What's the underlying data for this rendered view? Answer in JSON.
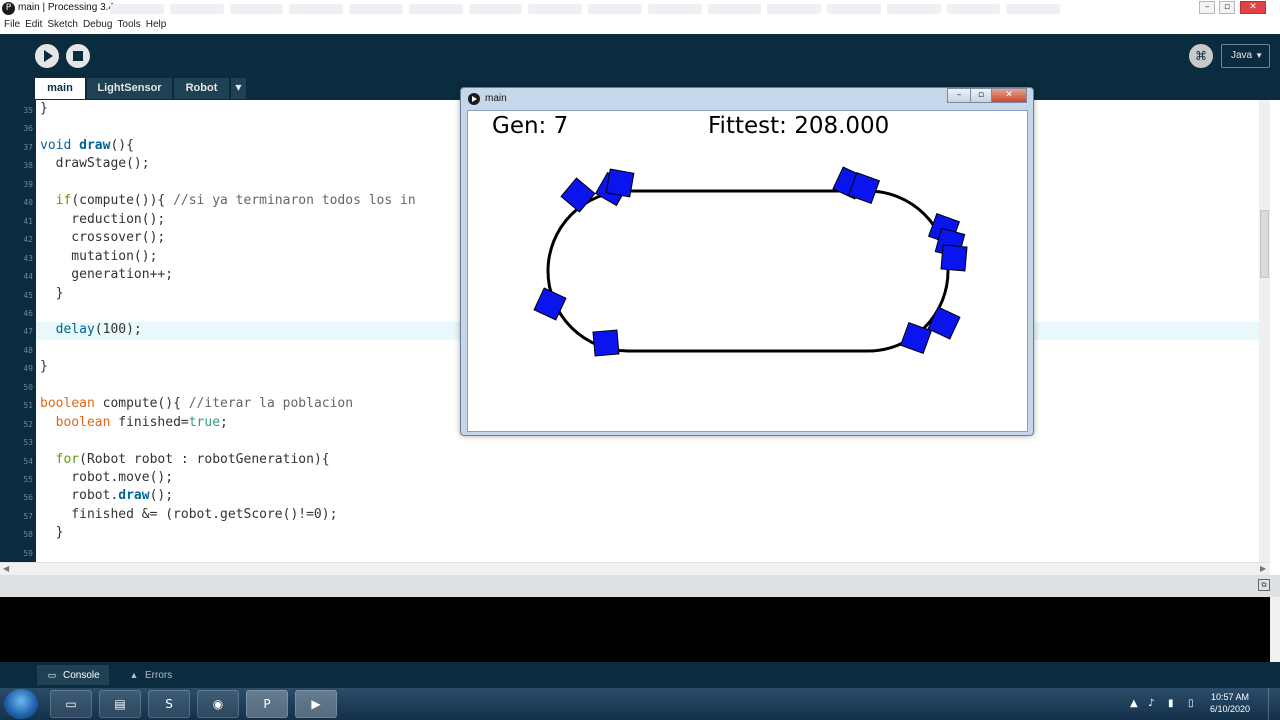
{
  "window": {
    "title": "main | Processing 3.4"
  },
  "menu": [
    "File",
    "Edit",
    "Sketch",
    "Debug",
    "Tools",
    "Help"
  ],
  "toolbar": {
    "mode": "Java"
  },
  "tabs": [
    "main",
    "LightSensor",
    "Robot"
  ],
  "editor": {
    "highlighted_line": 47,
    "lines": [
      {
        "n": 35,
        "tokens": [
          [
            "}",
            ""
          ]
        ]
      },
      {
        "n": 36,
        "tokens": []
      },
      {
        "n": 37,
        "tokens": [
          [
            "void ",
            "kw-blue"
          ],
          [
            "draw",
            "kw-fn"
          ],
          [
            "(){",
            ""
          ]
        ]
      },
      {
        "n": 38,
        "tokens": [
          [
            "  drawStage();",
            ""
          ]
        ]
      },
      {
        "n": 39,
        "tokens": []
      },
      {
        "n": 40,
        "tokens": [
          [
            "  ",
            ""
          ],
          [
            "if",
            "kw-ctrl"
          ],
          [
            "(compute()){ ",
            ""
          ],
          [
            "//si ya terminaron todos los in",
            "cmt"
          ]
        ]
      },
      {
        "n": 41,
        "tokens": [
          [
            "    reduction();",
            ""
          ]
        ]
      },
      {
        "n": 42,
        "tokens": [
          [
            "    crossover();",
            ""
          ]
        ]
      },
      {
        "n": 43,
        "tokens": [
          [
            "    mutation();",
            ""
          ]
        ]
      },
      {
        "n": 44,
        "tokens": [
          [
            "    generation++;",
            ""
          ]
        ]
      },
      {
        "n": 45,
        "tokens": [
          [
            "  }",
            ""
          ]
        ]
      },
      {
        "n": 46,
        "tokens": []
      },
      {
        "n": 47,
        "tokens": [
          [
            "  ",
            ""
          ],
          [
            "delay",
            "kw-blue"
          ],
          [
            "(100);",
            ""
          ]
        ]
      },
      {
        "n": 48,
        "tokens": []
      },
      {
        "n": 49,
        "tokens": [
          [
            "}",
            ""
          ]
        ]
      },
      {
        "n": 50,
        "tokens": []
      },
      {
        "n": 51,
        "tokens": [
          [
            "boolean",
            "kw-type"
          ],
          [
            " compute(){ ",
            ""
          ],
          [
            "//iterar la poblacion",
            "cmt"
          ]
        ]
      },
      {
        "n": 52,
        "tokens": [
          [
            "  ",
            ""
          ],
          [
            "boolean",
            "kw-type"
          ],
          [
            " finished=",
            ""
          ],
          [
            "true",
            "kw-lit"
          ],
          [
            ";",
            ""
          ]
        ]
      },
      {
        "n": 53,
        "tokens": []
      },
      {
        "n": 54,
        "tokens": [
          [
            "  ",
            ""
          ],
          [
            "for",
            "kw-ctrl"
          ],
          [
            "(Robot robot : robotGeneration){",
            ""
          ]
        ]
      },
      {
        "n": 55,
        "tokens": [
          [
            "    robot.move();",
            ""
          ]
        ]
      },
      {
        "n": 56,
        "tokens": [
          [
            "    robot.",
            ""
          ],
          [
            "draw",
            "kw-method"
          ],
          [
            "();",
            ""
          ]
        ]
      },
      {
        "n": 57,
        "tokens": [
          [
            "    finished &= (robot.getScore()!=0);",
            ""
          ]
        ]
      },
      {
        "n": 58,
        "tokens": [
          [
            "  }",
            ""
          ]
        ]
      },
      {
        "n": 59,
        "tokens": []
      }
    ]
  },
  "console_tabs": [
    "Console",
    "Errors"
  ],
  "sketch": {
    "title": "main",
    "gen_label": "Gen:",
    "gen_value": "7",
    "fittest_label": "Fittest:",
    "fittest_value": "208.000",
    "robot_color": "#0a14ee"
  },
  "clock": {
    "time": "10:57 AM",
    "date": "6/10/2020"
  },
  "colors": {
    "ide_dark": "#0b2c3f",
    "ide_tab": "#1e4153",
    "highlight_line": "#e9f8fb"
  }
}
